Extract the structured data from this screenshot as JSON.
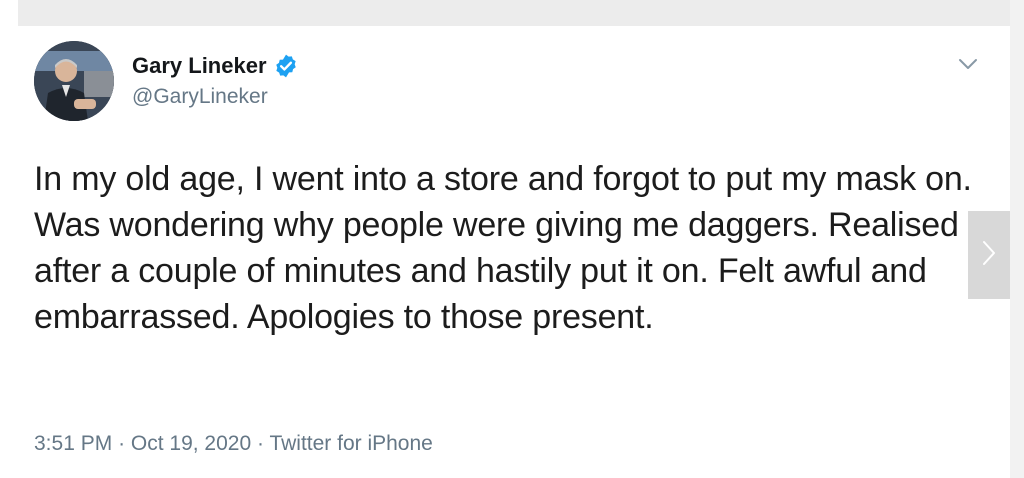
{
  "tweet": {
    "author_name": "Gary Lineker",
    "author_handle": "@GaryLineker",
    "verified": true,
    "text": "In my old age, I went into a store and forgot to put my mask on. Was wondering why people were giving me daggers. Realised after a couple of minutes and hastily put it on. Felt awful and embarrassed. Apologies to those present.",
    "time": "3:51 PM",
    "date": "Oct 19, 2020",
    "source": "Twitter for iPhone",
    "separator": "·"
  },
  "icons": {
    "verified": "verified-badge-icon",
    "menu": "chevron-down-icon",
    "next": "chevron-right-icon"
  },
  "colors": {
    "verified_blue": "#1da1f2",
    "text_primary": "#14171a",
    "text_secondary": "#657786",
    "top_band": "#ececec",
    "arrow_bg": "#d8d8d8"
  }
}
